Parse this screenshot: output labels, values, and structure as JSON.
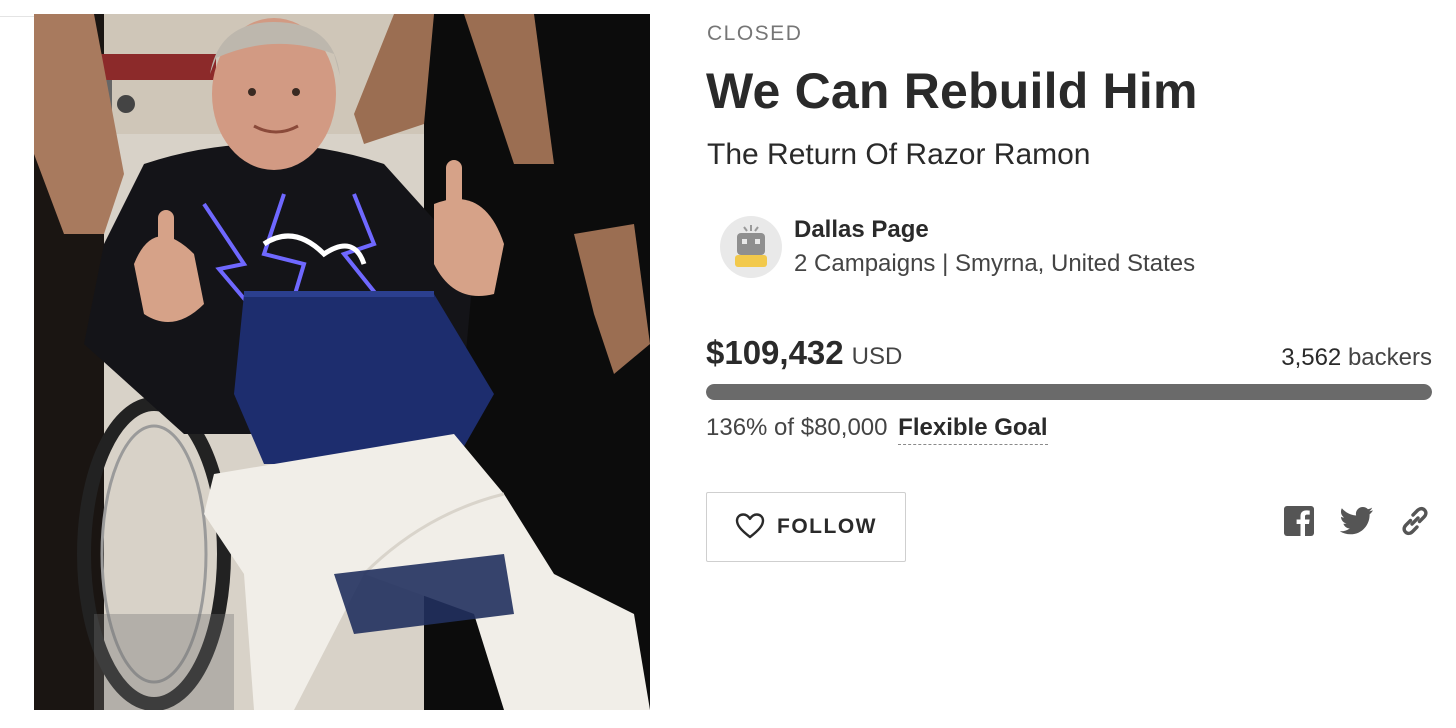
{
  "campaign": {
    "status": "CLOSED",
    "title": "We Can Rebuild Him",
    "tagline": "The Return Of Razor Ramon"
  },
  "owner": {
    "name": "Dallas Page",
    "meta": "2 Campaigns | Smyrna, United States",
    "avatar_icon": "robot-avatar-icon"
  },
  "funding": {
    "amount": "$109,432",
    "currency": "USD",
    "backers_count": "3,562",
    "backers_label": "backers",
    "percent_text": "136% of $80,000",
    "goal_type": "Flexible Goal",
    "progress_fraction": 1.0
  },
  "actions": {
    "follow_label": "FOLLOW",
    "follow_icon": "heart-icon",
    "share_icons": [
      "facebook-icon",
      "twitter-icon",
      "link-icon"
    ]
  },
  "colors": {
    "progress_fill": "#6a6a6a",
    "progress_track": "#e6e6e6",
    "text_dark": "#2a2a2a",
    "text_muted": "#767676"
  }
}
